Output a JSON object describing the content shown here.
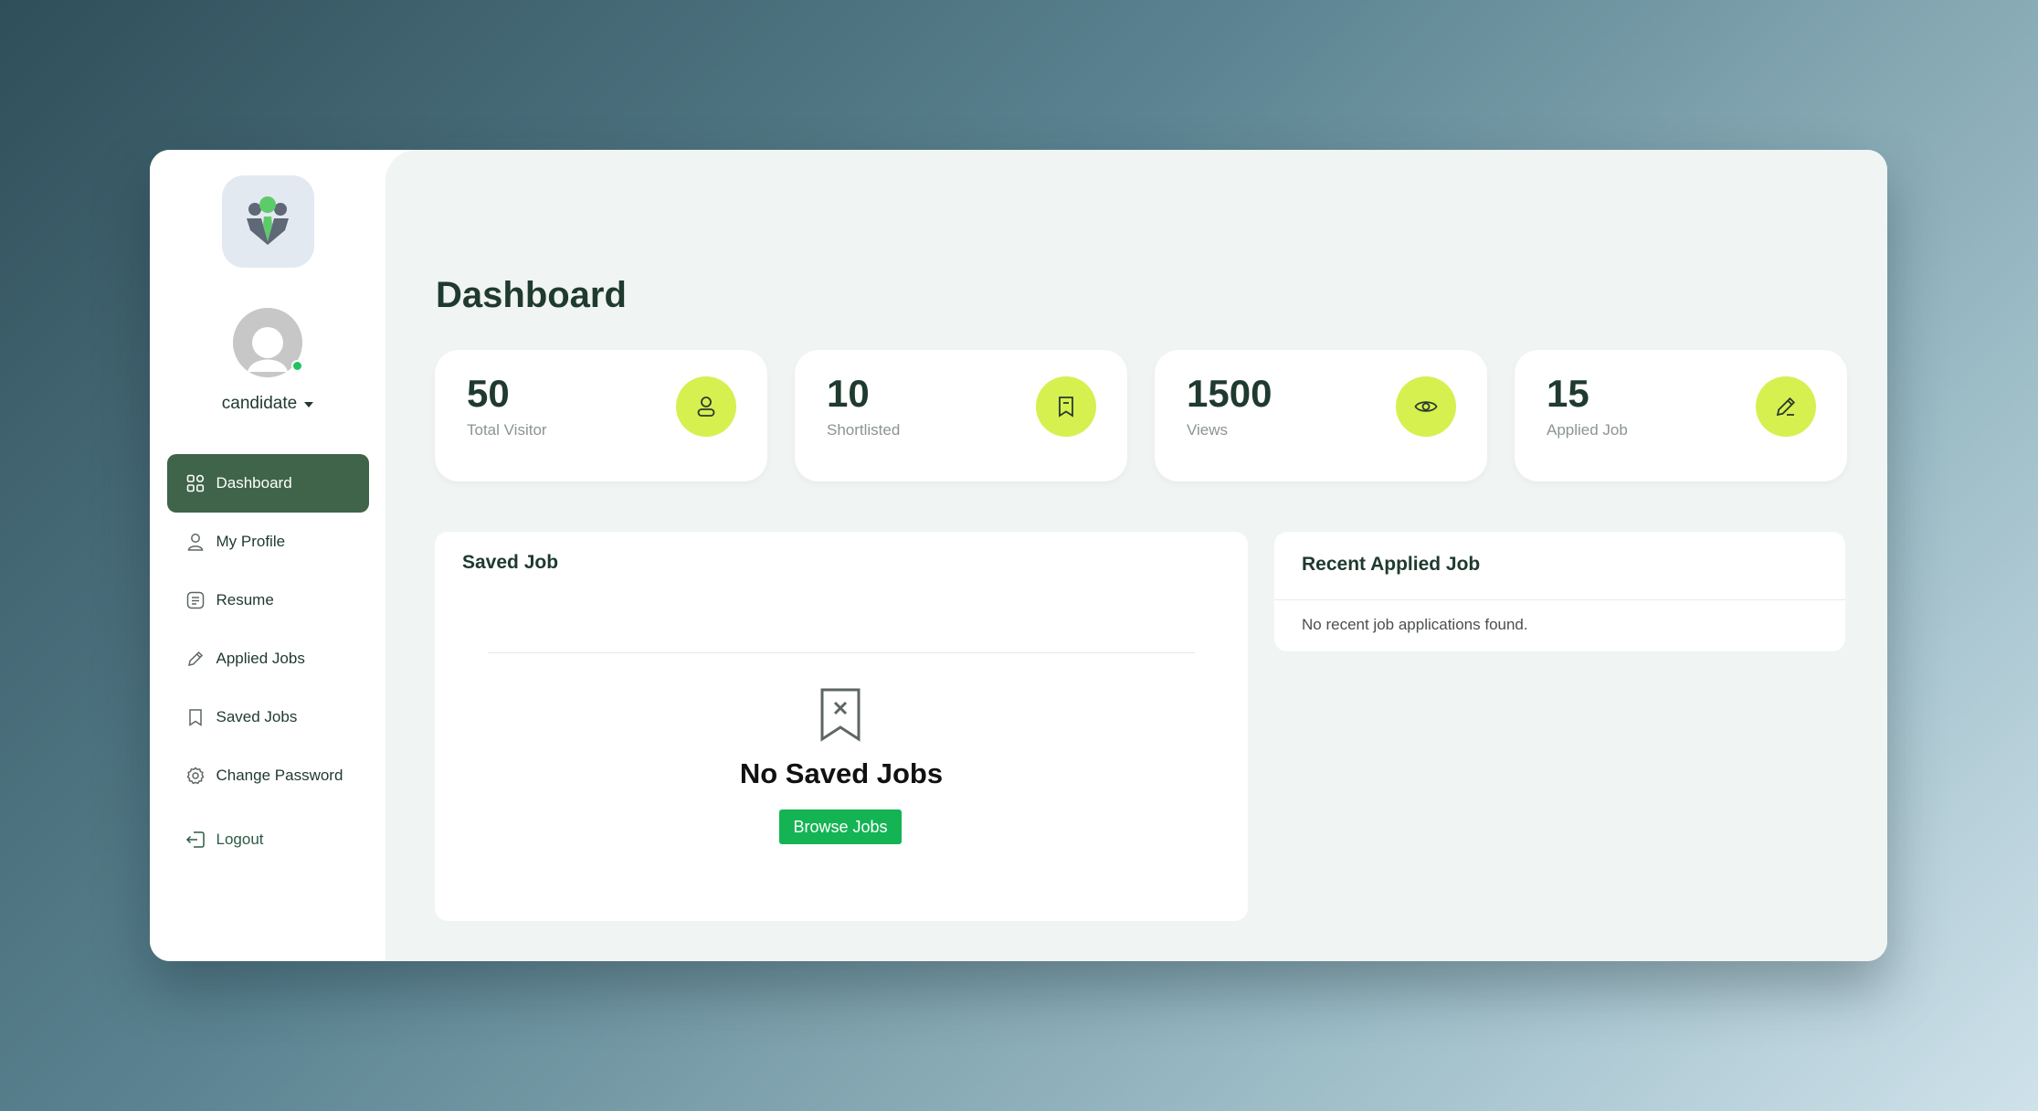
{
  "user": {
    "name": "candidate"
  },
  "sidebar": {
    "items": [
      {
        "label": "Dashboard",
        "icon": "dashboard-icon",
        "active": true
      },
      {
        "label": "My Profile",
        "icon": "user-icon"
      },
      {
        "label": "Resume",
        "icon": "resume-icon"
      },
      {
        "label": "Applied Jobs",
        "icon": "pencil-icon"
      },
      {
        "label": "Saved Jobs",
        "icon": "bookmark-icon"
      },
      {
        "label": "Change Password",
        "icon": "gear-icon"
      }
    ],
    "logout_label": "Logout"
  },
  "main": {
    "title": "Dashboard",
    "stats": [
      {
        "value": "50",
        "label": "Total Visitor",
        "icon": "user-icon"
      },
      {
        "value": "10",
        "label": "Shortlisted",
        "icon": "bookmark-icon"
      },
      {
        "value": "1500",
        "label": "Views",
        "icon": "eye-icon"
      },
      {
        "value": "15",
        "label": "Applied Job",
        "icon": "pencil-icon"
      }
    ],
    "saved": {
      "title": "Saved Job",
      "empty_title": "No Saved Jobs",
      "browse_label": "Browse Jobs"
    },
    "recent": {
      "title": "Recent Applied Job",
      "empty_text": "No recent job applications found."
    }
  },
  "colors": {
    "accent_dark": "#3f6449",
    "accent_lime": "#d6f04f",
    "button_green": "#14b454",
    "online": "#22c35e"
  }
}
